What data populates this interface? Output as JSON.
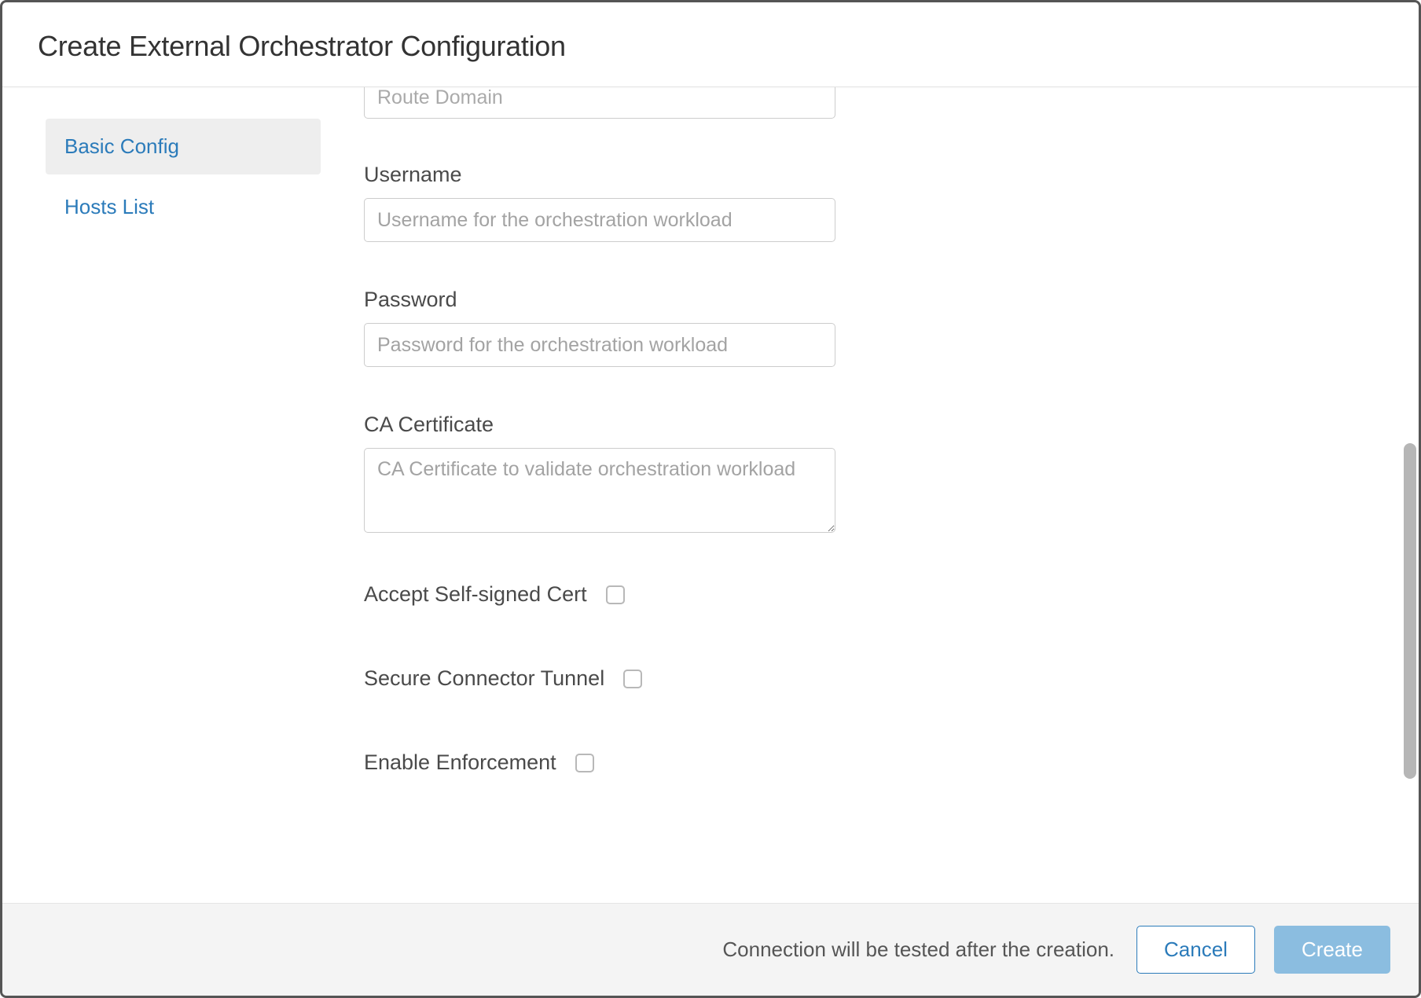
{
  "modal": {
    "title": "Create External Orchestrator Configuration"
  },
  "sidebar": {
    "items": [
      {
        "label": "Basic Config",
        "active": true
      },
      {
        "label": "Hosts List",
        "active": false
      }
    ]
  },
  "form": {
    "route_domain": {
      "placeholder": "Route Domain",
      "value": ""
    },
    "username": {
      "label": "Username",
      "placeholder": "Username for the orchestration workload",
      "value": ""
    },
    "password": {
      "label": "Password",
      "placeholder": "Password for the orchestration workload",
      "value": ""
    },
    "ca_certificate": {
      "label": "CA Certificate",
      "placeholder": "CA Certificate to validate orchestration workload",
      "value": ""
    },
    "accept_self_signed": {
      "label": "Accept Self-signed Cert",
      "checked": false
    },
    "secure_connector_tunnel": {
      "label": "Secure Connector Tunnel",
      "checked": false
    },
    "enable_enforcement": {
      "label": "Enable Enforcement",
      "checked": false
    }
  },
  "footer": {
    "hint": "Connection will be tested after the creation.",
    "cancel": "Cancel",
    "create": "Create"
  }
}
